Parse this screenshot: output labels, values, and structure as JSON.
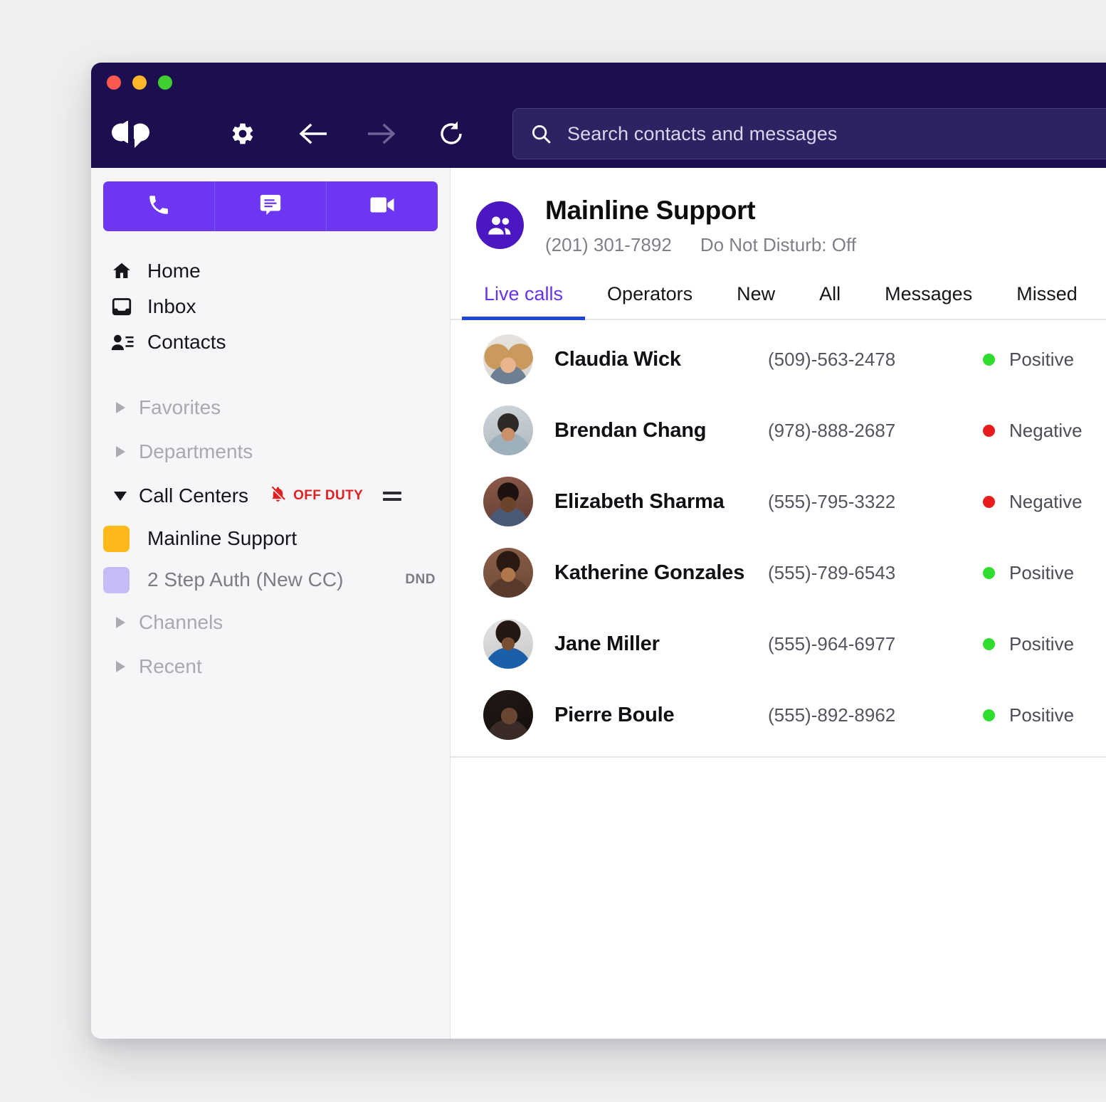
{
  "window": {
    "traffic_lights": [
      "close",
      "minimize",
      "maximize"
    ],
    "brand_color": "#1d0f4f",
    "accent_purple": "#6c36f2",
    "accent_blue": "#2045d9"
  },
  "toolbar": {
    "logo_name": "dialpad-logo",
    "settings_label": "Settings",
    "back_label": "Back",
    "forward_label": "Forward",
    "reload_label": "Reload"
  },
  "search": {
    "value": "",
    "placeholder": "Search contacts and messages"
  },
  "sidebar": {
    "actions": [
      {
        "name": "call-button",
        "icon": "phone-icon"
      },
      {
        "name": "message-button",
        "icon": "chat-icon"
      },
      {
        "name": "video-button",
        "icon": "video-camera-icon"
      }
    ],
    "nav": [
      {
        "label": "Home",
        "icon": "home-icon"
      },
      {
        "label": "Inbox",
        "icon": "inbox-icon"
      },
      {
        "label": "Contacts",
        "icon": "contacts-icon"
      }
    ],
    "groups": [
      {
        "label": "Favorites",
        "expanded": false
      },
      {
        "label": "Departments",
        "expanded": false
      },
      {
        "label": "Call Centers",
        "expanded": true,
        "badge": {
          "text": "OFF DUTY",
          "icon": "bell-off-icon",
          "color": "#e32020"
        },
        "handle_icon": "drag-handle-icon",
        "children": [
          {
            "label": "Mainline Support",
            "swatch": "#ffba1a",
            "muted": false,
            "tag": ""
          },
          {
            "label": "2 Step Auth (New CC)",
            "swatch": "#c7bbf5",
            "muted": true,
            "tag": "DND"
          }
        ]
      },
      {
        "label": "Channels",
        "expanded": false
      },
      {
        "label": "Recent",
        "expanded": false
      }
    ]
  },
  "main": {
    "header": {
      "avatar_icon": "group-people-icon",
      "title": "Mainline Support",
      "phone": "(201) 301-7892",
      "dnd_status": "Do Not Disturb: Off"
    },
    "tabs": [
      {
        "label": "Live calls",
        "active": true
      },
      {
        "label": "Operators",
        "active": false
      },
      {
        "label": "New",
        "active": false
      },
      {
        "label": "All",
        "active": false
      },
      {
        "label": "Messages",
        "active": false
      },
      {
        "label": "Missed",
        "active": false
      }
    ],
    "calls": [
      {
        "name": "Claudia Wick",
        "phone": "(509)-563-2478",
        "sentiment": "Positive",
        "sentiment_color": "#2fdd2f",
        "avatar": "av1"
      },
      {
        "name": "Brendan Chang",
        "phone": "(978)-888-2687",
        "sentiment": "Negative",
        "sentiment_color": "#e81c1c",
        "avatar": "av2"
      },
      {
        "name": "Elizabeth Sharma",
        "phone": "(555)-795-3322",
        "sentiment": "Negative",
        "sentiment_color": "#e81c1c",
        "avatar": "av3"
      },
      {
        "name": "Katherine Gonzales",
        "phone": "(555)-789-6543",
        "sentiment": "Positive",
        "sentiment_color": "#2fdd2f",
        "avatar": "av4"
      },
      {
        "name": "Jane Miller",
        "phone": "(555)-964-6977",
        "sentiment": "Positive",
        "sentiment_color": "#2fdd2f",
        "avatar": "av5"
      },
      {
        "name": "Pierre Boule",
        "phone": "(555)-892-8962",
        "sentiment": "Positive",
        "sentiment_color": "#2fdd2f",
        "avatar": "av6"
      }
    ]
  }
}
